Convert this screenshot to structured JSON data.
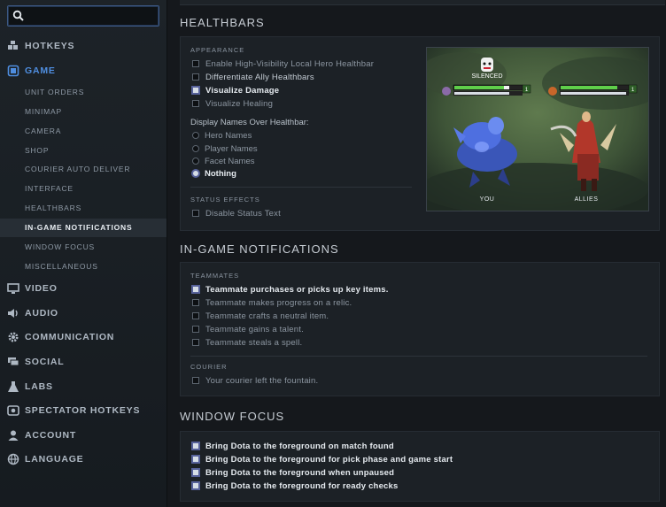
{
  "search": {
    "placeholder": ""
  },
  "sidebar": {
    "items": [
      {
        "label": "HOTKEYS",
        "icon": "keyboard-icon"
      },
      {
        "label": "GAME",
        "icon": "game-icon",
        "active": true
      },
      {
        "label": "VIDEO",
        "icon": "monitor-icon"
      },
      {
        "label": "AUDIO",
        "icon": "speaker-icon"
      },
      {
        "label": "COMMUNICATION",
        "icon": "gear-icon"
      },
      {
        "label": "SOCIAL",
        "icon": "chat-icon"
      },
      {
        "label": "LABS",
        "icon": "flask-icon"
      },
      {
        "label": "SPECTATOR HOTKEYS",
        "icon": "eye-icon"
      },
      {
        "label": "ACCOUNT",
        "icon": "user-icon"
      },
      {
        "label": "LANGUAGE",
        "icon": "globe-icon"
      }
    ],
    "game_subitems": [
      "UNIT ORDERS",
      "MINIMAP",
      "CAMERA",
      "SHOP",
      "COURIER AUTO DELIVER",
      "INTERFACE",
      "HEALTHBARS",
      "IN-GAME NOTIFICATIONS",
      "WINDOW FOCUS",
      "MISCELLANEOUS"
    ]
  },
  "healthbars": {
    "title": "HEALTHBARS",
    "appearance_label": "APPEARANCE",
    "appearance_options": [
      {
        "label": "Enable High-Visibility Local Hero Healthbar",
        "checked": false
      },
      {
        "label": "Differentiate Ally Healthbars",
        "checked": false
      },
      {
        "label": "Visualize Damage",
        "checked": true
      },
      {
        "label": "Visualize Healing",
        "checked": false
      }
    ],
    "display_names_label": "Display Names Over Healthbar:",
    "display_names_options": [
      {
        "label": "Hero Names",
        "selected": false
      },
      {
        "label": "Player Names",
        "selected": false
      },
      {
        "label": "Facet Names",
        "selected": false
      },
      {
        "label": "Nothing",
        "selected": true
      }
    ],
    "status_effects_label": "STATUS EFFECTS",
    "status_effects_options": [
      {
        "label": "Disable Status Text",
        "checked": false
      }
    ],
    "preview": {
      "status": "SILENCED",
      "you_label": "YOU",
      "allies_label": "ALLIES",
      "level_you": "1",
      "level_ally": "1"
    }
  },
  "notifications": {
    "title": "IN-GAME NOTIFICATIONS",
    "teammates_label": "TEAMMATES",
    "teammates_options": [
      {
        "label": "Teammate purchases or picks up key items.",
        "checked": true
      },
      {
        "label": "Teammate makes progress on a relic.",
        "checked": false
      },
      {
        "label": "Teammate crafts a neutral item.",
        "checked": false
      },
      {
        "label": "Teammate gains a talent.",
        "checked": false
      },
      {
        "label": "Teammate steals a spell.",
        "checked": false
      }
    ],
    "courier_label": "COURIER",
    "courier_options": [
      {
        "label": "Your courier left the fountain.",
        "checked": false
      }
    ]
  },
  "window_focus": {
    "title": "WINDOW FOCUS",
    "options": [
      {
        "label": "Bring Dota to the foreground on match found",
        "checked": true
      },
      {
        "label": "Bring Dota to the foreground for pick phase and game start",
        "checked": true
      },
      {
        "label": "Bring Dota to the foreground when unpaused",
        "checked": true
      },
      {
        "label": "Bring Dota to the foreground for ready checks",
        "checked": true
      }
    ]
  },
  "colors": {
    "accent": "#4f8ee0",
    "panel": "#1c2126",
    "sidebar": "#1d2328"
  }
}
